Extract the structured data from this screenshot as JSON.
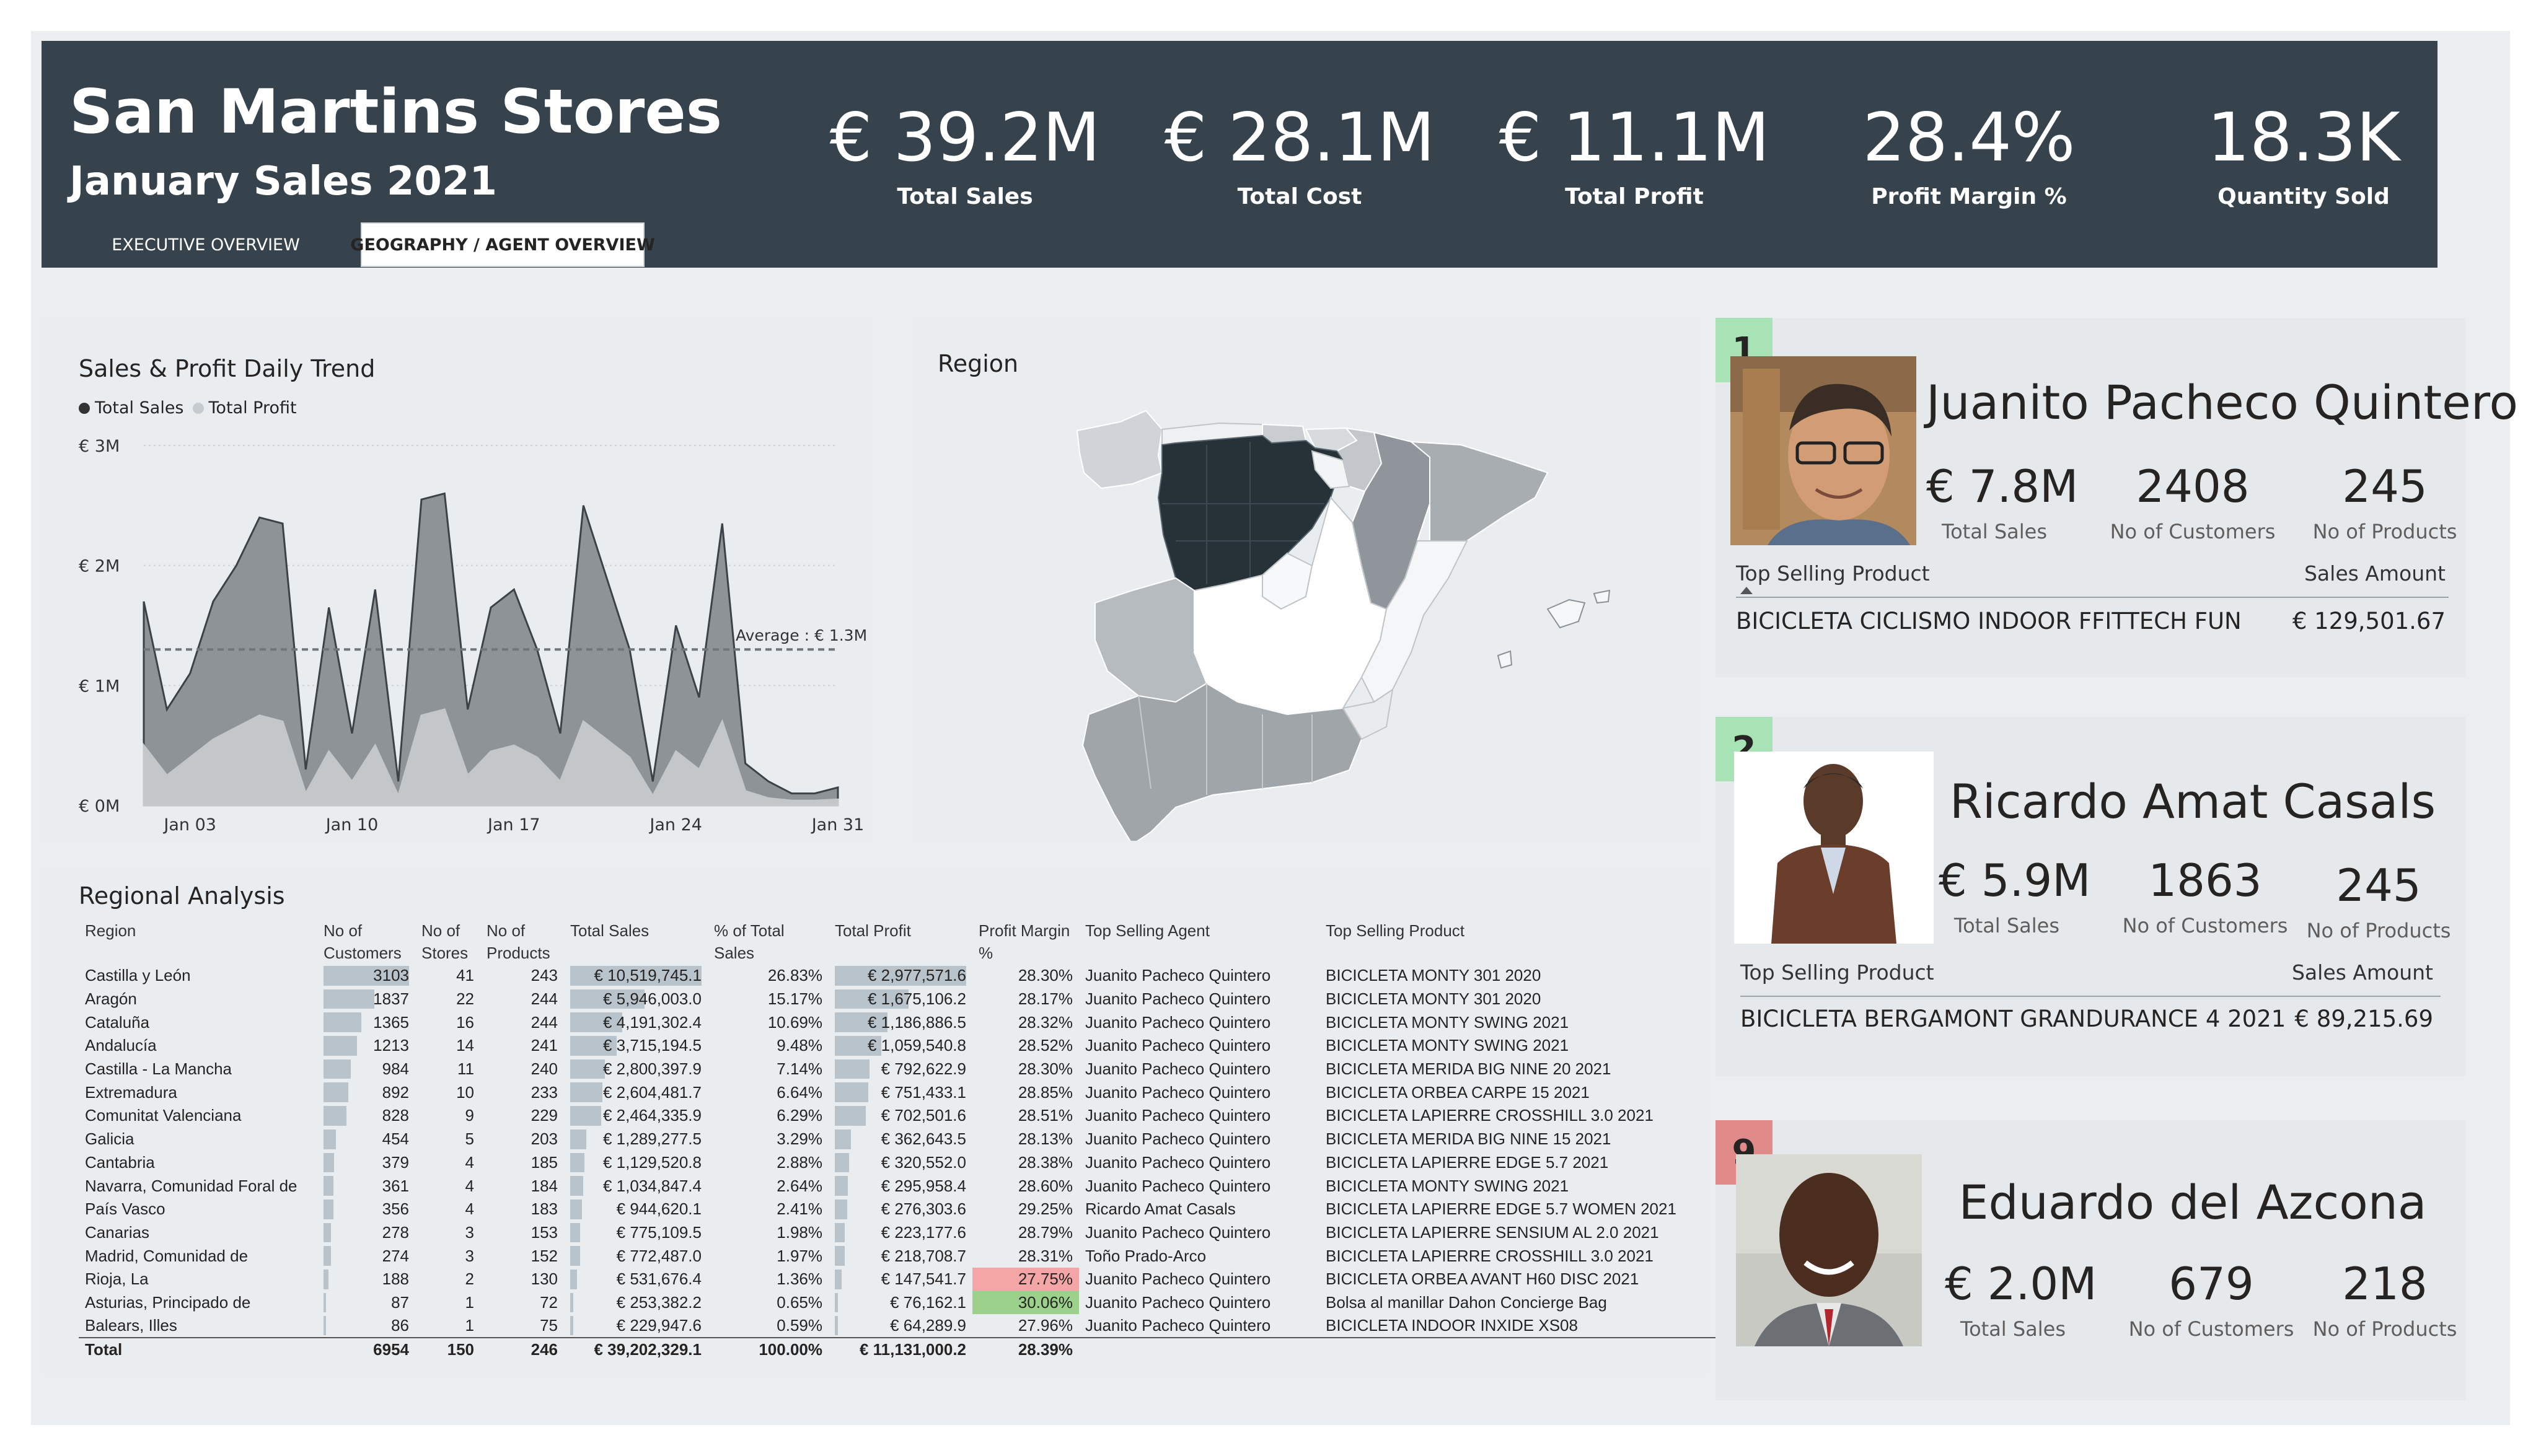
{
  "header": {
    "title": "San Martins Stores",
    "subtitle": "January Sales 2021",
    "tabs": [
      "EXECUTIVE OVERVIEW",
      "GEOGRAPHY / AGENT OVERVIEW"
    ],
    "kpis": [
      {
        "value": "€ 39.2M",
        "label": "Total Sales"
      },
      {
        "value": "€ 28.1M",
        "label": "Total Cost"
      },
      {
        "value": "€ 11.1M",
        "label": "Total Profit"
      },
      {
        "value": "28.4%",
        "label": "Profit Margin %"
      },
      {
        "value": "18.3K",
        "label": "Quantity Sold"
      }
    ]
  },
  "trend": {
    "title": "Sales & Profit Daily Trend",
    "legend": [
      "Total Sales",
      "Total Profit"
    ],
    "yticks": [
      "€ 3M",
      "€ 2M",
      "€ 1M",
      "€ 0M"
    ],
    "xticks": [
      "Jan 03",
      "Jan 10",
      "Jan 17",
      "Jan 24",
      "Jan 31"
    ],
    "average_label": "Average : € 1.3M"
  },
  "chart_data": {
    "type": "area",
    "title": "Sales & Profit Daily Trend",
    "x": [
      1,
      2,
      3,
      4,
      5,
      6,
      7,
      8,
      9,
      10,
      11,
      12,
      13,
      14,
      15,
      16,
      17,
      18,
      19,
      20,
      21,
      22,
      23,
      24,
      25,
      26,
      27,
      28,
      29,
      30,
      31
    ],
    "ylim": [
      0,
      3000000
    ],
    "series": [
      {
        "name": "Total Sales",
        "values": [
          1700000,
          800000,
          1100000,
          1700000,
          2000000,
          2400000,
          2350000,
          300000,
          1650000,
          600000,
          1800000,
          200000,
          2550000,
          2600000,
          800000,
          1650000,
          1800000,
          1300000,
          600000,
          2500000,
          1900000,
          1300000,
          200000,
          1500000,
          900000,
          2350000,
          350000,
          200000,
          100000,
          100000,
          150000
        ]
      },
      {
        "name": "Total Profit",
        "values": [
          500000,
          250000,
          400000,
          550000,
          650000,
          750000,
          700000,
          100000,
          450000,
          200000,
          500000,
          80000,
          750000,
          800000,
          250000,
          450000,
          500000,
          400000,
          200000,
          700000,
          550000,
          400000,
          80000,
          450000,
          300000,
          700000,
          120000,
          60000,
          40000,
          40000,
          50000
        ]
      }
    ],
    "average": 1300000
  },
  "map": {
    "title": "Region"
  },
  "regional": {
    "title": "Regional Analysis",
    "columns": [
      "Region",
      "No of Customers",
      "No of Stores",
      "No of Products",
      "Total Sales",
      "% of Total Sales",
      "Total Profit",
      "Profit Margin %",
      "Top Selling Agent",
      "Top Selling Product"
    ],
    "rows": [
      [
        "Castilla y León",
        "3103",
        "41",
        "243",
        "€ 10,519,745.1",
        "26.83%",
        "€ 2,977,571.6",
        "28.30%",
        "Juanito Pacheco Quintero",
        "BICICLETA MONTY 301 2020"
      ],
      [
        "Aragón",
        "1837",
        "22",
        "244",
        "€ 5,946,003.0",
        "15.17%",
        "€ 1,675,106.2",
        "28.17%",
        "Juanito Pacheco Quintero",
        "BICICLETA MONTY 301 2020"
      ],
      [
        "Cataluña",
        "1365",
        "16",
        "244",
        "€ 4,191,302.4",
        "10.69%",
        "€ 1,186,886.5",
        "28.32%",
        "Juanito Pacheco Quintero",
        "BICICLETA MONTY SWING 2021"
      ],
      [
        "Andalucía",
        "1213",
        "14",
        "241",
        "€ 3,715,194.5",
        "9.48%",
        "€ 1,059,540.8",
        "28.52%",
        "Juanito Pacheco Quintero",
        "BICICLETA MONTY SWING 2021"
      ],
      [
        "Castilla - La Mancha",
        "984",
        "11",
        "240",
        "€ 2,800,397.9",
        "7.14%",
        "€ 792,622.9",
        "28.30%",
        "Juanito Pacheco Quintero",
        "BICICLETA MERIDA BIG NINE 20 2021"
      ],
      [
        "Extremadura",
        "892",
        "10",
        "233",
        "€ 2,604,481.7",
        "6.64%",
        "€ 751,433.1",
        "28.85%",
        "Juanito Pacheco Quintero",
        "BICICLETA ORBEA CARPE 15 2021"
      ],
      [
        "Comunitat Valenciana",
        "828",
        "9",
        "229",
        "€ 2,464,335.9",
        "6.29%",
        "€ 702,501.6",
        "28.51%",
        "Juanito Pacheco Quintero",
        "BICICLETA LAPIERRE CROSSHILL 3.0 2021"
      ],
      [
        "Galicia",
        "454",
        "5",
        "203",
        "€ 1,289,277.5",
        "3.29%",
        "€ 362,643.5",
        "28.13%",
        "Juanito Pacheco Quintero",
        "BICICLETA MERIDA BIG NINE 15 2021"
      ],
      [
        "Cantabria",
        "379",
        "4",
        "185",
        "€ 1,129,520.8",
        "2.88%",
        "€ 320,552.0",
        "28.38%",
        "Juanito Pacheco Quintero",
        "BICICLETA LAPIERRE EDGE 5.7 2021"
      ],
      [
        "Navarra, Comunidad Foral de",
        "361",
        "4",
        "184",
        "€ 1,034,847.4",
        "2.64%",
        "€ 295,958.4",
        "28.60%",
        "Juanito Pacheco Quintero",
        "BICICLETA MONTY SWING 2021"
      ],
      [
        "País Vasco",
        "356",
        "4",
        "183",
        "€ 944,620.1",
        "2.41%",
        "€ 276,303.6",
        "29.25%",
        "Ricardo Amat Casals",
        "BICICLETA LAPIERRE EDGE 5.7 WOMEN 2021"
      ],
      [
        "Canarias",
        "278",
        "3",
        "153",
        "€ 775,109.5",
        "1.98%",
        "€ 223,177.6",
        "28.79%",
        "Juanito Pacheco Quintero",
        "BICICLETA LAPIERRE SENSIUM AL 2.0 2021"
      ],
      [
        "Madrid, Comunidad de",
        "274",
        "3",
        "152",
        "€ 772,487.0",
        "1.97%",
        "€ 218,708.7",
        "28.31%",
        "Toño Prado-Arco",
        "BICICLETA LAPIERRE CROSSHILL 3.0 2021"
      ],
      [
        "Rioja, La",
        "188",
        "2",
        "130",
        "€ 531,676.4",
        "1.36%",
        "€ 147,541.7",
        "27.75%",
        "Juanito Pacheco Quintero",
        "BICICLETA ORBEA AVANT H60 DISC 2021"
      ],
      [
        "Asturias, Principado de",
        "87",
        "1",
        "72",
        "€ 253,382.2",
        "0.65%",
        "€ 76,162.1",
        "30.06%",
        "Juanito Pacheco Quintero",
        "Bolsa al manillar Dahon Concierge Bag"
      ],
      [
        "Balears, Illes",
        "86",
        "1",
        "75",
        "€ 229,947.6",
        "0.59%",
        "€ 64,289.9",
        "27.96%",
        "Juanito Pacheco Quintero",
        "BICICLETA INDOOR INXIDE XS08"
      ]
    ],
    "total": [
      "Total",
      "6954",
      "150",
      "246",
      "€ 39,202,329.1",
      "100.00%",
      "€ 11,131,000.2",
      "28.39%",
      "",
      ""
    ],
    "colors": {
      "low_margin": "#f4a6a6",
      "high_margin": "#9bd18b",
      "bar": "#b9c3cc"
    }
  },
  "agents": [
    {
      "rank": "1",
      "name": "Juanito Pacheco Quintero",
      "sales": "€ 7.8M",
      "customers": "2408",
      "products": "245",
      "sales_label": "Total Sales",
      "customers_label": "No of Customers",
      "products_label": "No of Products",
      "tsp_label": "Top Selling Product",
      "sa_label": "Sales Amount",
      "product": "BICICLETA CICLISMO INDOOR FFITTECH FUN",
      "amount": "€ 129,501.67",
      "rank_color": "#a8e3b5"
    },
    {
      "rank": "2",
      "name": "Ricardo Amat Casals",
      "sales": "€ 5.9M",
      "customers": "1863",
      "products": "245",
      "sales_label": "Total Sales",
      "customers_label": "No of Customers",
      "products_label": "No of Products",
      "tsp_label": "Top Selling Product",
      "sa_label": "Sales Amount",
      "product": "BICICLETA BERGAMONT GRANDURANCE 4 2021",
      "amount": "€ 89,215.69",
      "rank_color": "#a8e3b5"
    },
    {
      "rank": "9",
      "name": "Eduardo del Azcona",
      "sales": "€ 2.0M",
      "customers": "679",
      "products": "218",
      "sales_label": "Total Sales",
      "customers_label": "No of Customers",
      "products_label": "No of Products",
      "rank_color": "#e08a8a"
    }
  ]
}
